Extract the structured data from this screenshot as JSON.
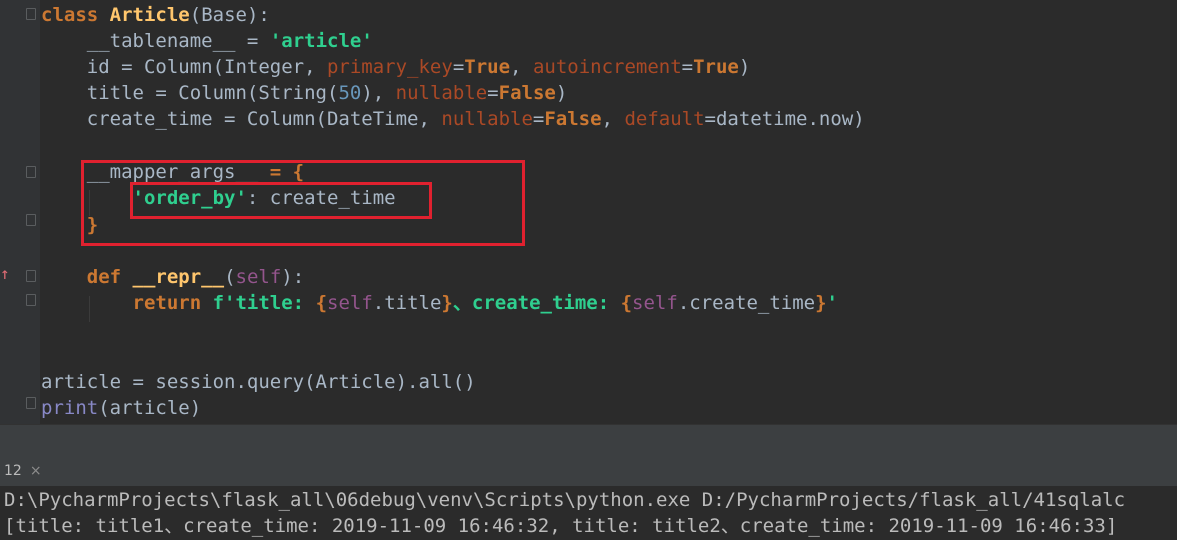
{
  "code": {
    "line1": {
      "kw": "class",
      "name": "Article",
      "open": "(",
      "base": "Base",
      "close": "):"
    },
    "line2": {
      "attr": "__tablename__",
      "eq": " = ",
      "val": "'article'"
    },
    "line3": {
      "lhs": "id = Column(Integer, ",
      "kw1": "primary_key",
      "eq1": "=",
      "v1": "True",
      "sep": ", ",
      "kw2": "autoincrement",
      "eq2": "=",
      "v2": "True",
      "end": ")"
    },
    "line4": {
      "lhs": "title = Column(String(",
      "num": "50",
      "mid": "), ",
      "kw": "nullable",
      "eq": "=",
      "v": "False",
      "end": ")"
    },
    "line5": {
      "lhs": "create_time = Column(DateTime, ",
      "kw1": "nullable",
      "eq1": "=",
      "v1": "False",
      "sep": ", ",
      "kw2": "default",
      "eq2": "=",
      "rest": "datetime.now)"
    },
    "line6": {
      "attr": "__mapper_args__",
      "rest": " = {"
    },
    "line7": {
      "key": "'order_by'",
      "rest": ": create_time"
    },
    "line8": {
      "brace": "}"
    },
    "line9": {
      "kw": "def",
      "name": "__repr__",
      "open": "(",
      "self": "self",
      "close": "):"
    },
    "line10": {
      "kw": "return",
      "f": "f'title: ",
      "b1": "{",
      "self1": "self",
      "attr1": ".title",
      "b2": "}",
      "mid": "、create_time: ",
      "b3": "{",
      "self2": "self",
      "attr2": ".create_time",
      "b4": "}",
      "q": "'"
    },
    "line11": {
      "text": "article = session.query(Article).all()"
    },
    "line12": {
      "fn": "print",
      "rest": "(article)"
    }
  },
  "run_tab": {
    "label": "12",
    "close": "×"
  },
  "console": {
    "command": "D:\\PycharmProjects\\flask_all\\06debug\\venv\\Scripts\\python.exe D:/PycharmProjects/flask_all/41sqlalc",
    "output": "[title: title1、create_time: 2019-11-09 16:46:32, title: title2、create_time: 2019-11-09 16:46:33]"
  }
}
